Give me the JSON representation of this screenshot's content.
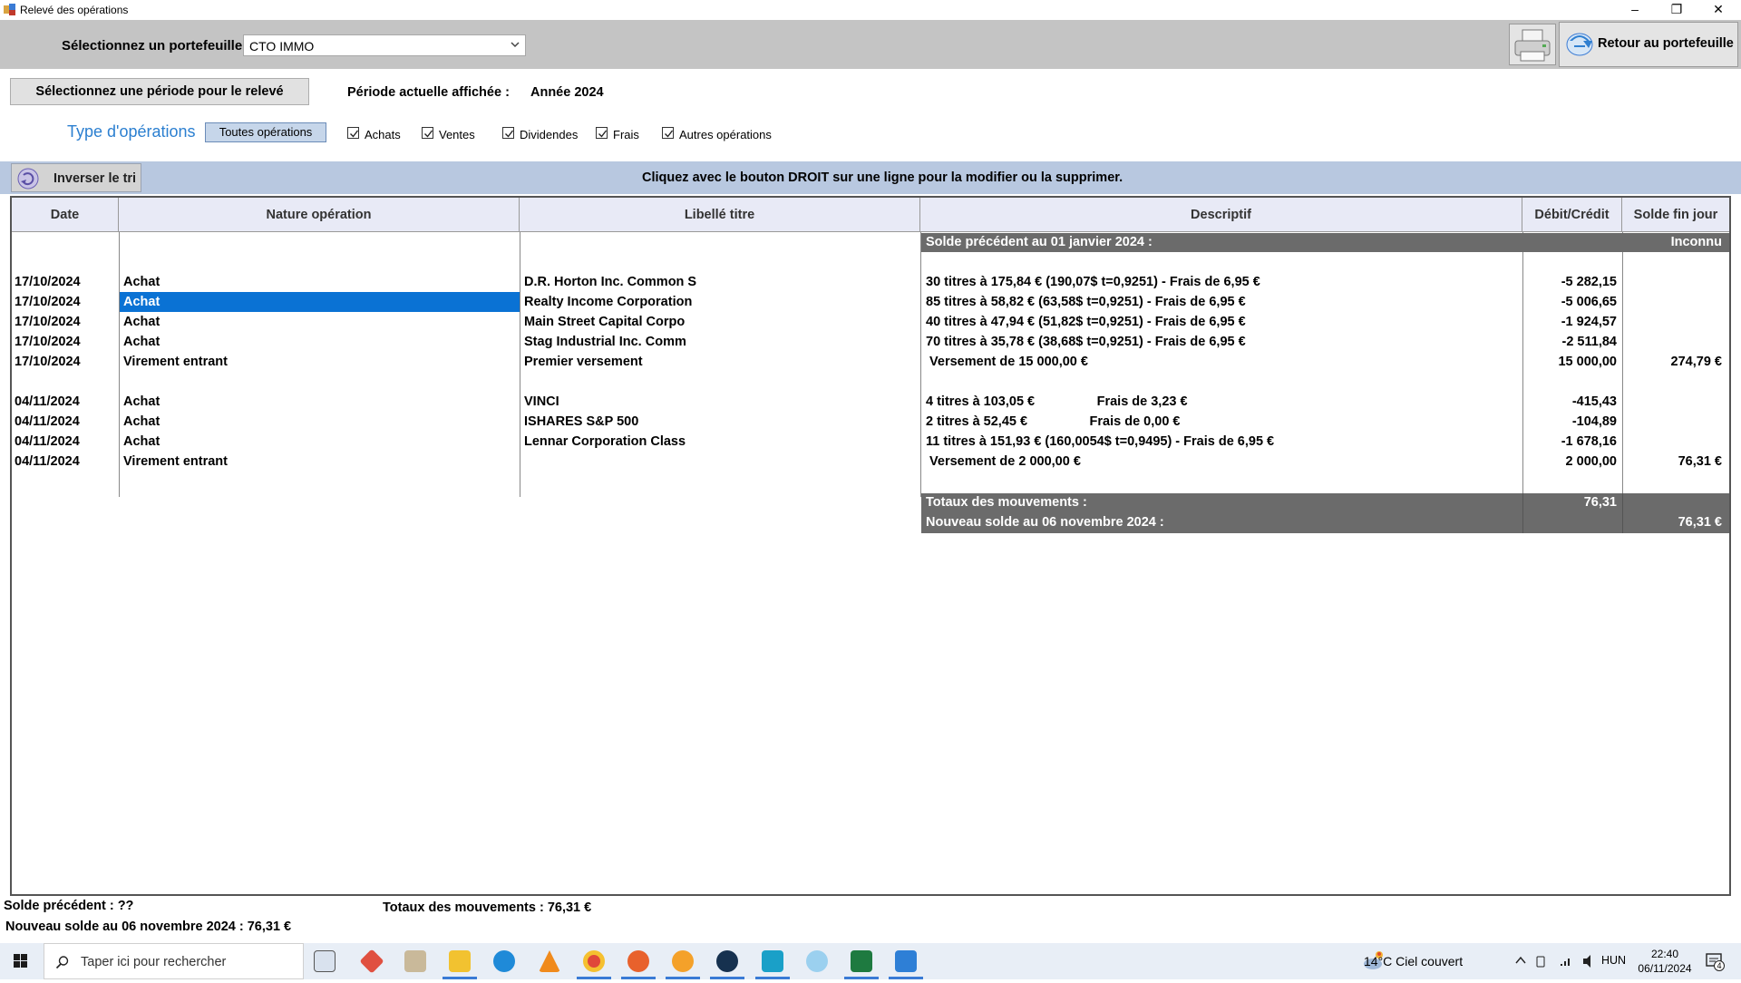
{
  "window": {
    "title": "Relevé des opérations",
    "minimize": "–",
    "restore": "❐",
    "close": "✕"
  },
  "toolbar": {
    "portfolio_label": "Sélectionnez un portefeuille",
    "portfolio_value": "CTO IMMO",
    "return_label": "Retour au portefeuille"
  },
  "period": {
    "button_label": "Sélectionnez une période pour le relevé",
    "current_label": "Période actuelle affichée :",
    "current_value": "Année 2024"
  },
  "filters": {
    "type_label": "Type d'opérations",
    "all_label": "Toutes opérations",
    "checkboxes": [
      {
        "label": "Achats",
        "checked": true
      },
      {
        "label": "Ventes",
        "checked": true
      },
      {
        "label": "Dividendes",
        "checked": true
      },
      {
        "label": "Frais",
        "checked": true
      },
      {
        "label": "Autres opérations",
        "checked": true
      }
    ]
  },
  "sortbar": {
    "sort_label": "Inverser le tri",
    "hint": "Cliquez avec le bouton DROIT sur une ligne pour la modifier ou la supprimer."
  },
  "table": {
    "headers": [
      "Date",
      "Nature opération",
      "Libellé titre",
      "Descriptif",
      "Débit/Crédit",
      "Solde fin jour"
    ],
    "opening": {
      "label": "Solde précédent au 01 janvier 2024 :",
      "balance": "Inconnu"
    },
    "rows": [
      {
        "date": "17/10/2024",
        "nature": "Achat",
        "titre": "D.R. Horton Inc. Common S",
        "desc": "30 titres à 175,84 € (190,07$  t=0,9251) - Frais de 6,95 €",
        "amount": "-5 282,15",
        "balance": ""
      },
      {
        "date": "17/10/2024",
        "nature": "Achat",
        "titre": "Realty Income Corporation",
        "desc": "85 titres à 58,82 € (63,58$  t=0,9251) - Frais de 6,95 €",
        "amount": "-5 006,65",
        "balance": ""
      },
      {
        "date": "17/10/2024",
        "nature": "Achat",
        "titre": "Main Street Capital Corpo",
        "desc": "40 titres à 47,94 € (51,82$  t=0,9251) - Frais de 6,95 €",
        "amount": "-1 924,57",
        "balance": ""
      },
      {
        "date": "17/10/2024",
        "nature": "Achat",
        "titre": "Stag Industrial Inc. Comm",
        "desc": "70 titres à 35,78 € (38,68$  t=0,9251) - Frais de 6,95 €",
        "amount": "-2 511,84",
        "balance": ""
      },
      {
        "date": "17/10/2024",
        "nature": "Virement entrant",
        "titre": "Premier versement",
        "desc": " Versement de 15 000,00 €",
        "amount": "15 000,00",
        "balance": "274,79 €"
      },
      {
        "date": "04/11/2024",
        "nature": "Achat",
        "titre": "VINCI",
        "desc": "4 titres à 103,05 €                 Frais de 3,23 €",
        "amount": "-415,43",
        "balance": ""
      },
      {
        "date": "04/11/2024",
        "nature": "Achat",
        "titre": "ISHARES S&P 500",
        "desc": "2 titres à 52,45 €                 Frais de 0,00 €",
        "amount": "-104,89",
        "balance": ""
      },
      {
        "date": "04/11/2024",
        "nature": "Achat",
        "titre": "Lennar Corporation Class",
        "desc": "11 titres à 151,93 € (160,0054$  t=0,9495) - Frais de 6,95 €",
        "amount": "-1 678,16",
        "balance": ""
      },
      {
        "date": "04/11/2024",
        "nature": "Virement entrant",
        "titre": "",
        "desc": " Versement de 2 000,00 €",
        "amount": "2 000,00",
        "balance": "76,31 €"
      }
    ],
    "totals": {
      "label": "Totaux des mouvements :",
      "amount": "76,31"
    },
    "closing": {
      "label": "Nouveau solde au 06 novembre 2024 :",
      "balance": "76,31 €"
    }
  },
  "footer": {
    "previous": "Solde précédent : ??",
    "totals": "Totaux des mouvements : 76,31 €",
    "new_balance": "Nouveau solde au 06 novembre 2024 : 76,31 €"
  },
  "taskbar": {
    "search_placeholder": "Taper ici pour rechercher",
    "weather": "14°C  Ciel couvert",
    "lang": "HUN",
    "time": "22:40",
    "date": "06/11/2024",
    "notifications": "4",
    "colors": {
      "accent": "#0a72d4",
      "dark_row": "#6b6b6b",
      "blue_band": "#b8c8e0",
      "type_label": "#2b7fd0"
    }
  }
}
